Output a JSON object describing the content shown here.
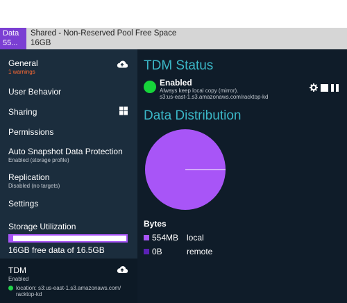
{
  "top_strip": {
    "badge_line1": "Data",
    "badge_line2": "55...",
    "title": "Shared - Non-Reserved Pool Free Space",
    "value": "16GB"
  },
  "sidebar": {
    "items": [
      {
        "label": "General",
        "sub": "1 warnings",
        "icon": "cloud-upload-icon"
      },
      {
        "label": "User Behavior"
      },
      {
        "label": "Sharing",
        "icon": "windows-icon"
      },
      {
        "label": "Permissions"
      },
      {
        "label": "Auto Snapshot Data Protection",
        "sub": "Enabled (storage profile)"
      },
      {
        "label": "Replication",
        "sub": "Disabled (no targets)"
      },
      {
        "label": "Settings"
      },
      {
        "label": "Storage Utilization"
      }
    ],
    "storage_text": "16GB free data of 16.5GB",
    "storage_used_fraction": 0.03,
    "tdm": {
      "label": "TDM",
      "sub": "Enabled",
      "location": "location: s3:us-east-1.s3.amazonaws.com/ racktop-kd",
      "icon": "cloud-upload-icon"
    }
  },
  "main": {
    "status_title": "TDM Status",
    "status_label": "Enabled",
    "status_line1": "Always keep local copy (mirror).",
    "status_line2": "s3:us-east-1.s3.amazonaws.com/racktop-kd",
    "distribution_title": "Data Distribution",
    "legend_title": "Bytes",
    "legend": [
      {
        "value": "554MB",
        "label": "local",
        "color": "#a855f7"
      },
      {
        "value": "0B",
        "label": "remote",
        "color": "#5b21b6"
      }
    ]
  },
  "chart_data": {
    "type": "pie",
    "categories": [
      "local",
      "remote"
    ],
    "values": [
      554,
      0
    ],
    "colors": [
      "#a855f7",
      "#5b21b6"
    ]
  },
  "colors": {
    "accent": "#3bb8c8",
    "purple": "#a855f7",
    "status_green": "#16d43a",
    "warning": "#ff6a33"
  }
}
